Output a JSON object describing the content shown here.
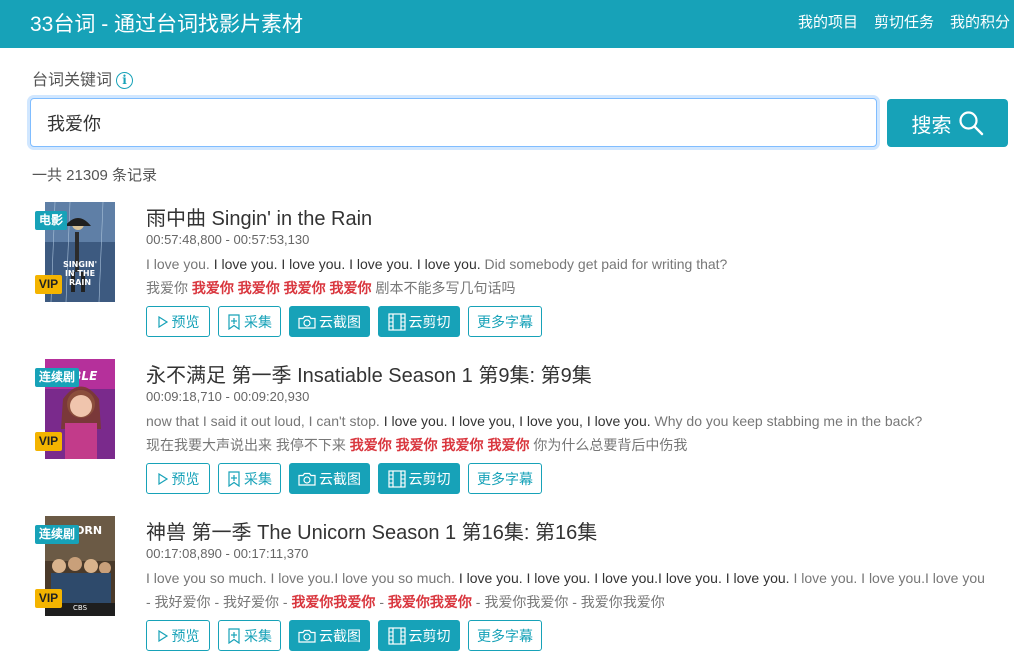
{
  "header": {
    "title": "33台词 - 通过台词找影片素材",
    "nav": [
      "我的项目",
      "剪切任务",
      "我的积分"
    ]
  },
  "search": {
    "label": "台词关键词",
    "value": "我爱你",
    "button_label": "搜索"
  },
  "count_text": "一共 21309 条记录",
  "results": [
    {
      "type": "电影",
      "vip": "VIP",
      "poster_text": [
        "SINGIN'",
        "IN THE",
        "RAIN"
      ],
      "title": "雨中曲 Singin' in the Rain",
      "time": "00:57:48,800 - 00:57:53,130",
      "en": [
        {
          "t": "I love you.  ",
          "h": false
        },
        {
          "t": "I love you. I love you. I love you. I love you.",
          "h": true
        },
        {
          "t": " Did somebody get paid for writing that?",
          "h": false
        }
      ],
      "zh": [
        {
          "t": "我爱你  ",
          "h": false
        },
        {
          "t": "我爱你 我爱你 我爱你 我爱你",
          "h": true
        },
        {
          "t": " 剧本不能多写几句话吗",
          "h": false
        }
      ]
    },
    {
      "type": "连续剧",
      "vip": "VIP",
      "poster_text": [
        "ABLE"
      ],
      "title": "永不满足 第一季 Insatiable Season 1 第9集: 第9集",
      "time": "00:09:18,710 - 00:09:20,930",
      "en": [
        {
          "t": "now that I said it out loud, I can't stop.  ",
          "h": false
        },
        {
          "t": "I love you. I love you, I love you, I love you.",
          "h": true
        },
        {
          "t": " Why do you keep stabbing me in the back?",
          "h": false
        }
      ],
      "zh": [
        {
          "t": "现在我要大声说出来 我停不下来  ",
          "h": false
        },
        {
          "t": "我爱你 我爱你 我爱你 我爱你",
          "h": true
        },
        {
          "t": " 你为什么总要背后中伤我",
          "h": false
        }
      ]
    },
    {
      "type": "连续剧",
      "vip": "VIP",
      "poster_text": [
        "CORN",
        "CBS"
      ],
      "title": "神兽 第一季 The Unicorn Season 1 第16集: 第16集",
      "time": "00:17:08,890 - 00:17:11,370",
      "en": [
        {
          "t": "I love you so much. I love you.I love you so much.  ",
          "h": false
        },
        {
          "t": "I love you. I love you. I love you.I love you. I love you.",
          "h": true
        },
        {
          "t": " I love you. I love you.I love you",
          "h": false
        }
      ],
      "zh": [
        {
          "t": "- 我好爱你 - 我好爱你  - ",
          "h": false
        },
        {
          "t": "我爱你我爱你",
          "h": true
        },
        {
          "t": " - ",
          "h": false
        },
        {
          "t": "我爱你我爱你",
          "h": true
        },
        {
          "t": " - 我爱你我爱你 - 我爱你我爱你",
          "h": false
        }
      ]
    }
  ],
  "actions": {
    "preview": "预览",
    "collect": "采集",
    "screenshot": "云截图",
    "cut": "云剪切",
    "more": "更多字幕"
  },
  "colors": {
    "accent": "#17a2b8",
    "highlight_zh": "#d9363e",
    "vip": "#f4b400"
  },
  "icons": [
    "info-icon",
    "search-icon",
    "play-icon",
    "bookmark-plus-icon",
    "camera-icon",
    "film-icon"
  ]
}
